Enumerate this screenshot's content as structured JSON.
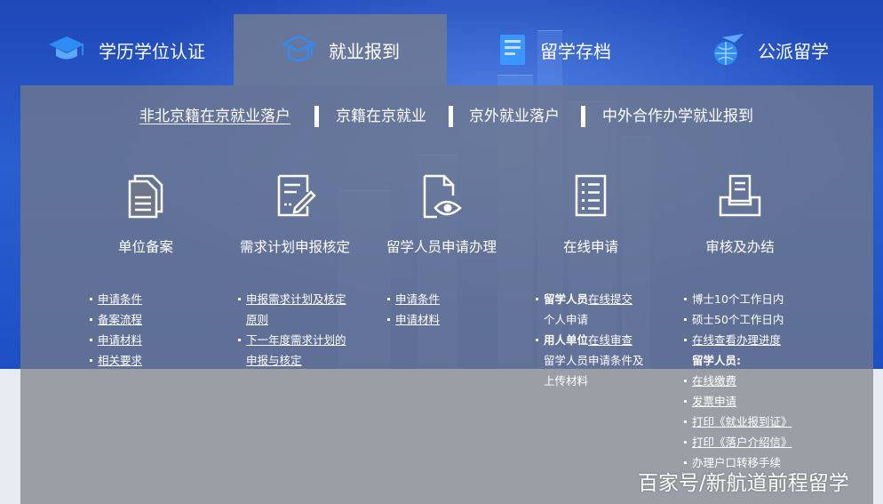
{
  "tabs": [
    {
      "label": "学历学位认证",
      "icon": "graduation-cap-icon",
      "active": false
    },
    {
      "label": "就业报到",
      "icon": "cap-outline-icon",
      "active": true
    },
    {
      "label": "留学存档",
      "icon": "archive-folder-icon",
      "active": false
    },
    {
      "label": "公派留学",
      "icon": "plane-globe-icon",
      "active": false
    }
  ],
  "subnav": [
    {
      "label": "非北京籍在京就业落户",
      "active": true
    },
    {
      "label": "京籍在京就业",
      "active": false
    },
    {
      "label": "京外就业落户",
      "active": false
    },
    {
      "label": "中外合作办学就业报到",
      "active": false
    }
  ],
  "columns": [
    {
      "title": "单位备案",
      "icon": "documents-icon",
      "items": [
        {
          "parts": [
            {
              "text": "申请条件",
              "style": "u"
            }
          ],
          "bullet": true
        },
        {
          "parts": [
            {
              "text": "备案流程",
              "style": "u"
            }
          ],
          "bullet": true
        },
        {
          "parts": [
            {
              "text": "申请材料",
              "style": "u"
            }
          ],
          "bullet": true
        },
        {
          "parts": [
            {
              "text": "相关要求",
              "style": "u"
            }
          ],
          "bullet": true
        }
      ]
    },
    {
      "title": "需求计划申报核定",
      "icon": "edit-document-icon",
      "items": [
        {
          "parts": [
            {
              "text": "申报需求计划及核定",
              "style": "u"
            }
          ],
          "bullet": true
        },
        {
          "parts": [
            {
              "text": "原则",
              "style": "u"
            }
          ],
          "bullet": false
        },
        {
          "parts": [
            {
              "text": "下一年度需求计划的",
              "style": "u"
            }
          ],
          "bullet": true
        },
        {
          "parts": [
            {
              "text": "申报与核定",
              "style": "u"
            }
          ],
          "bullet": false
        }
      ]
    },
    {
      "title": "留学人员申请办理",
      "icon": "document-eye-icon",
      "items": [
        {
          "parts": [
            {
              "text": "申请条件",
              "style": "u"
            }
          ],
          "bullet": true
        },
        {
          "parts": [
            {
              "text": "申请材料",
              "style": "u"
            }
          ],
          "bullet": true
        }
      ]
    },
    {
      "title": "在线申请",
      "icon": "checklist-icon",
      "items": [
        {
          "parts": [
            {
              "text": "留学人员",
              "style": "b"
            },
            {
              "text": "在线提交",
              "style": "u"
            }
          ],
          "bullet": true
        },
        {
          "parts": [
            {
              "text": "个人申请",
              "style": ""
            }
          ],
          "bullet": false
        },
        {
          "parts": [
            {
              "text": "用人单位",
              "style": "b"
            },
            {
              "text": "在线审查",
              "style": "u"
            }
          ],
          "bullet": true
        },
        {
          "parts": [
            {
              "text": "留学人员申请条件及",
              "style": ""
            }
          ],
          "bullet": false
        },
        {
          "parts": [
            {
              "text": "上传材料",
              "style": ""
            }
          ],
          "bullet": false
        }
      ]
    },
    {
      "title": "审核及办结",
      "icon": "inbox-tray-icon",
      "items": [
        {
          "parts": [
            {
              "text": "博士10个工作日内",
              "style": ""
            }
          ],
          "bullet": true
        },
        {
          "parts": [
            {
              "text": "硕士50个工作日内",
              "style": ""
            }
          ],
          "bullet": true
        },
        {
          "parts": [
            {
              "text": "在线查看办理进度",
              "style": "u"
            }
          ],
          "bullet": true
        },
        {
          "parts": [
            {
              "text": "留学人员:",
              "style": "b"
            }
          ],
          "bullet": false
        },
        {
          "parts": [
            {
              "text": "在线缴费",
              "style": "u"
            }
          ],
          "bullet": true
        },
        {
          "parts": [
            {
              "text": "发票申请",
              "style": "u"
            }
          ],
          "bullet": true
        },
        {
          "parts": [
            {
              "text": "打印《就业报到证》",
              "style": "u"
            }
          ],
          "bullet": true
        },
        {
          "parts": [
            {
              "text": "打印《落户介绍信》",
              "style": "u"
            }
          ],
          "bullet": true
        },
        {
          "parts": [
            {
              "text": "办理户口转移手续",
              "style": ""
            }
          ],
          "bullet": true
        }
      ]
    }
  ],
  "watermark": "百家号/新航道前程留学",
  "colors": {
    "hero": "#2a5fd0",
    "accent": "#2f7df0",
    "panel": "#6e768c"
  }
}
